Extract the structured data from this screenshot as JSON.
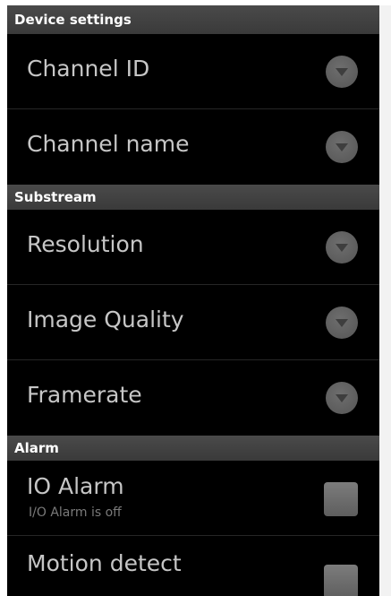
{
  "sections": [
    {
      "header": "Device settings",
      "items": [
        {
          "title": "Channel ID",
          "control": "dropdown-arrow-icon"
        },
        {
          "title": "Channel name",
          "control": "dropdown-arrow-icon"
        }
      ]
    },
    {
      "header": "Substream",
      "items": [
        {
          "title": "Resolution",
          "control": "dropdown-arrow-icon"
        },
        {
          "title": "Image Quality",
          "control": "dropdown-arrow-icon"
        },
        {
          "title": "Framerate",
          "control": "dropdown-arrow-icon"
        }
      ]
    },
    {
      "header": "Alarm",
      "items": [
        {
          "title": "IO Alarm",
          "summary": "I/O Alarm is off",
          "control": "checkbox-icon",
          "checked": false
        },
        {
          "title": "Motion detect",
          "control": "checkbox-icon",
          "checked": false
        }
      ]
    }
  ],
  "colors": {
    "background": "#000000",
    "header_background": "#404040",
    "title_text": "#c6c6c6",
    "summary_text": "#7a7a7a",
    "icon": "#636363"
  }
}
